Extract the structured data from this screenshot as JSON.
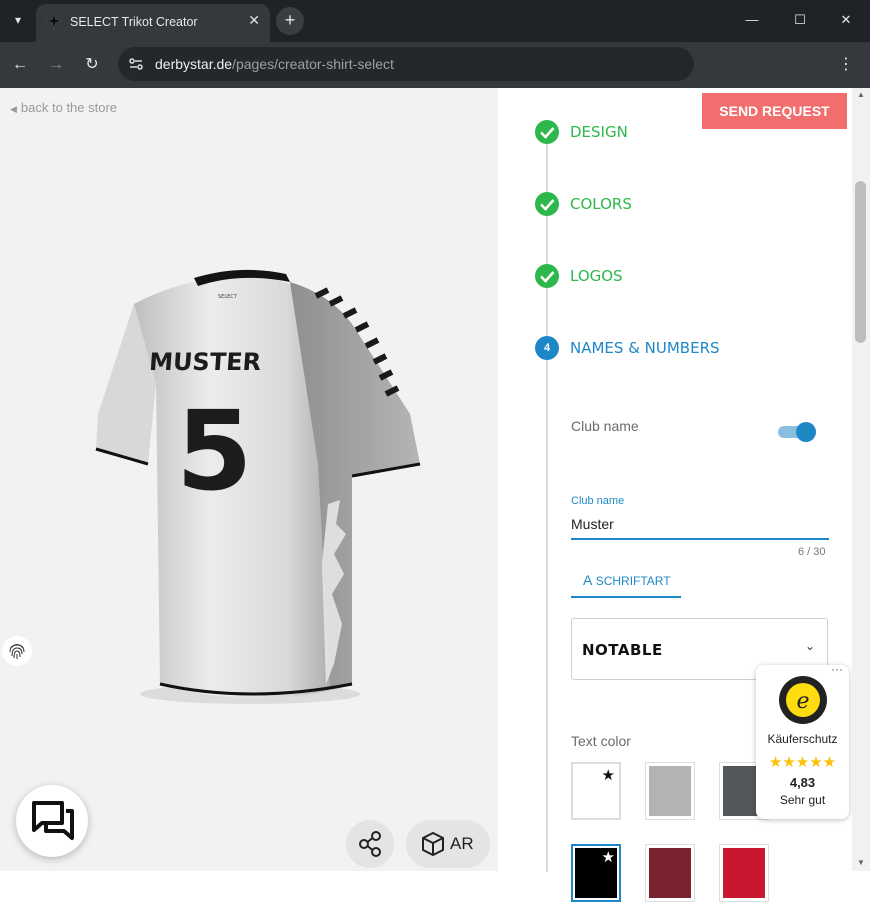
{
  "browser": {
    "tab_title": "SELECT Trikot Creator",
    "url_host": "derbystar.de",
    "url_path": "/pages/creator-shirt-select"
  },
  "viewer": {
    "back_link": "back to the store",
    "shirt_name": "MUSTER",
    "shirt_number": "5",
    "ar_label": "AR"
  },
  "panel": {
    "send_request": "SEND REQUEST",
    "steps": [
      {
        "label": "DESIGN",
        "status": "done"
      },
      {
        "label": "COLORS",
        "status": "done"
      },
      {
        "label": "LOGOS",
        "status": "done"
      },
      {
        "label": "NAMES & NUMBERS",
        "status": "active",
        "number": "4"
      }
    ],
    "club_name_toggle_label": "Club name",
    "club_name_enabled": true,
    "input_label": "Club name",
    "input_value": "Muster",
    "counter": "6 / 30",
    "font_tab_label": "SCHRIFTART",
    "font_value": "NOTABLE",
    "text_color_label": "Text color",
    "swatches": [
      "#ffffff",
      "#b3b3b3",
      "#54575c",
      "#000000",
      "#7a2430",
      "#c8172e"
    ]
  },
  "trust": {
    "title": "Käuferschutz",
    "stars": "★★★★★",
    "score": "4,83",
    "rating": "Sehr gut"
  },
  "colors": {
    "accent": "#1e88c7",
    "success": "#2cb84a",
    "send": "#f26d6d"
  }
}
